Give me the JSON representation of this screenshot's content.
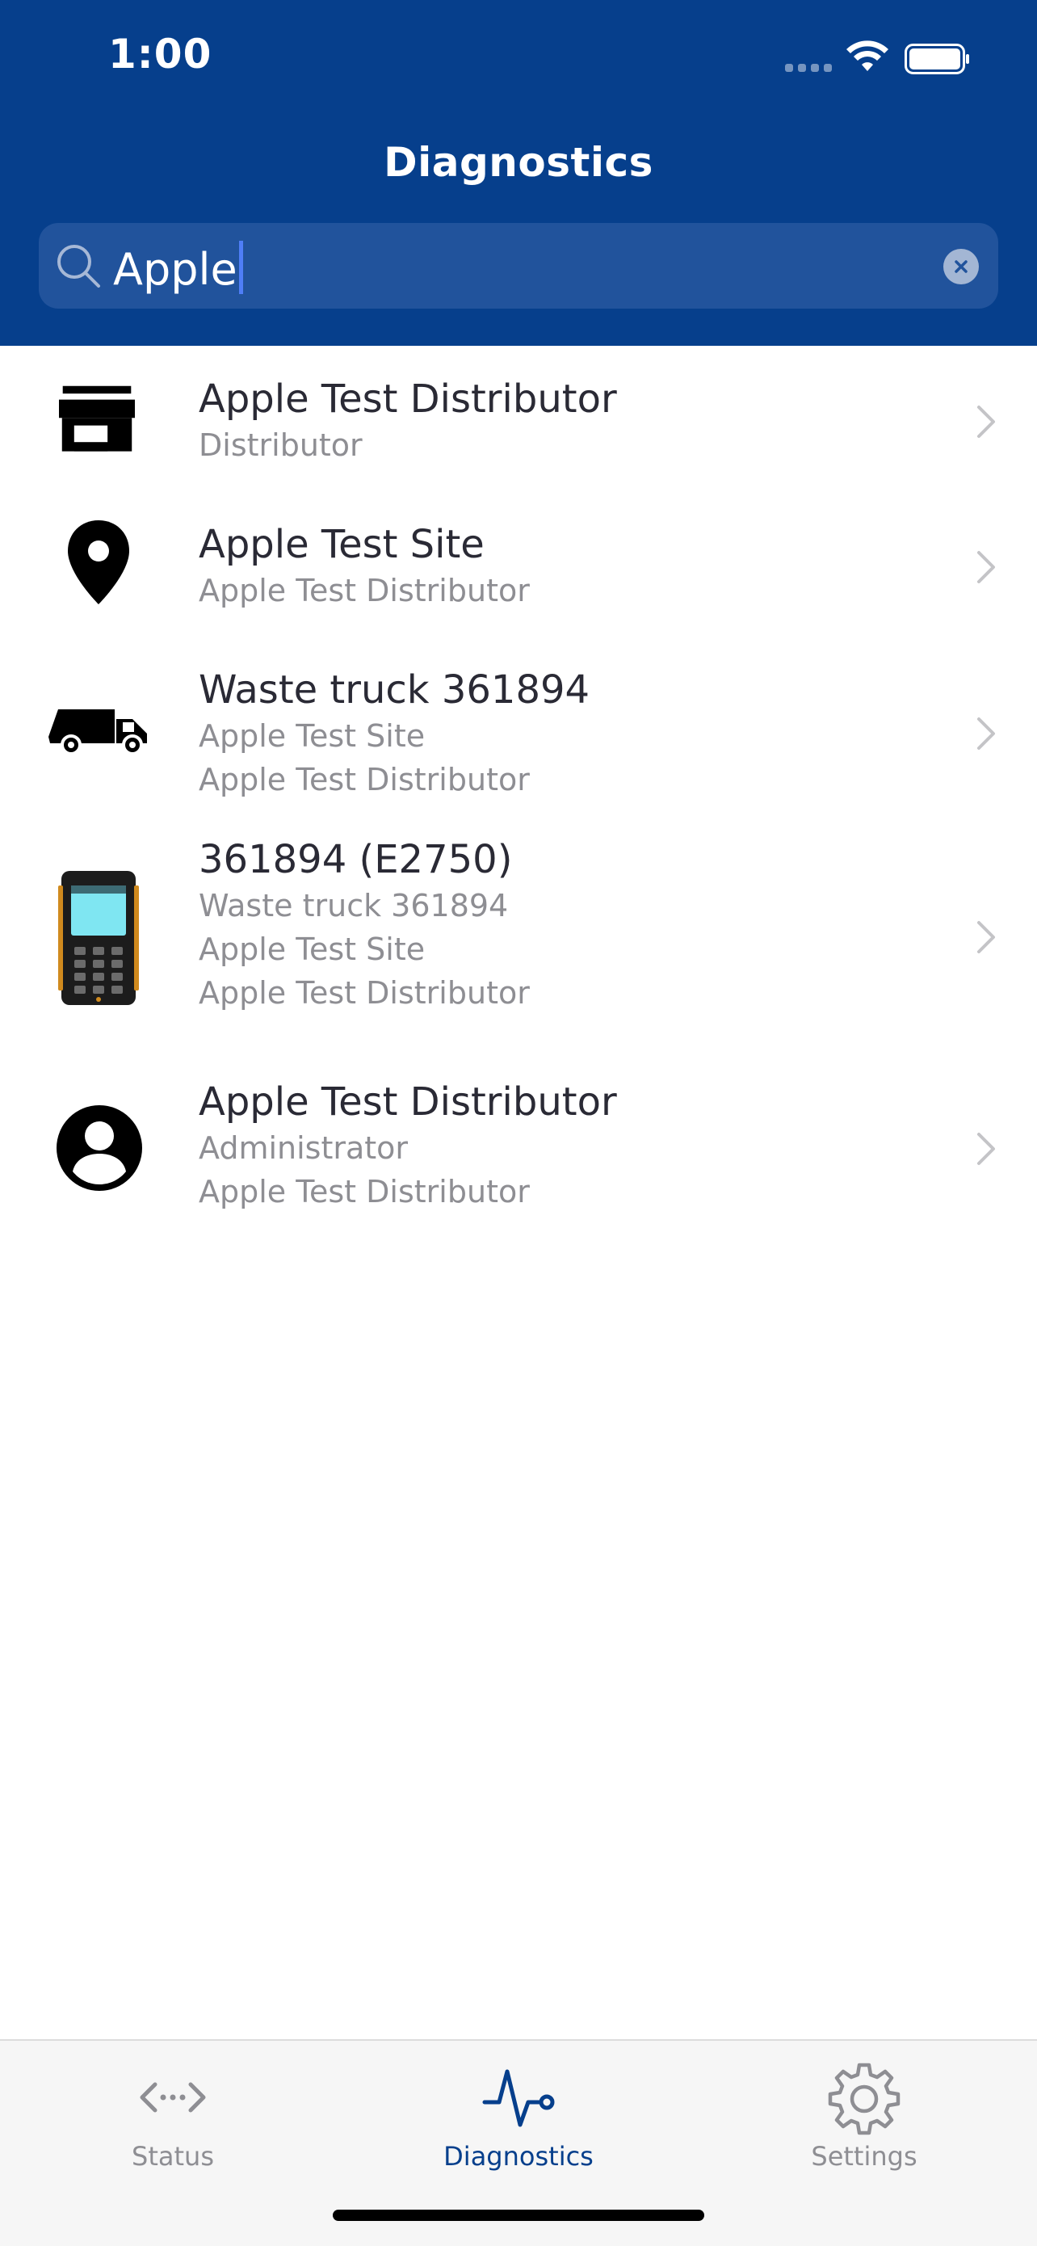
{
  "status_bar": {
    "time": "1:00"
  },
  "header": {
    "title": "Diagnostics"
  },
  "search": {
    "value": "Apple"
  },
  "results": [
    {
      "icon": "storefront-icon",
      "title": "Apple Test Distributor",
      "lines": [
        "Distributor"
      ]
    },
    {
      "icon": "location-pin-icon",
      "title": "Apple Test Site",
      "lines": [
        "Apple Test Distributor"
      ]
    },
    {
      "icon": "waste-truck-icon",
      "title": "Waste truck 361894",
      "lines": [
        "Apple Test Site",
        "Apple Test Distributor"
      ]
    },
    {
      "icon": "handheld-device-icon",
      "title": "361894 (E2750)",
      "lines": [
        "Waste truck 361894",
        "Apple Test Site",
        "Apple Test Distributor"
      ]
    },
    {
      "icon": "user-account-icon",
      "title": "Apple Test Distributor",
      "lines": [
        "Administrator",
        "Apple Test Distributor"
      ]
    }
  ],
  "tabs": [
    {
      "label": "Status",
      "icon": "status-icon",
      "active": false
    },
    {
      "label": "Diagnostics",
      "icon": "pulse-icon",
      "active": true
    },
    {
      "label": "Settings",
      "icon": "gear-icon",
      "active": false
    }
  ],
  "colors": {
    "header_bg": "#063f8c",
    "search_bg": "#21539c",
    "accent": "#063f8c",
    "caret": "#4f7ef7",
    "secondary_text": "#8e8e93"
  }
}
